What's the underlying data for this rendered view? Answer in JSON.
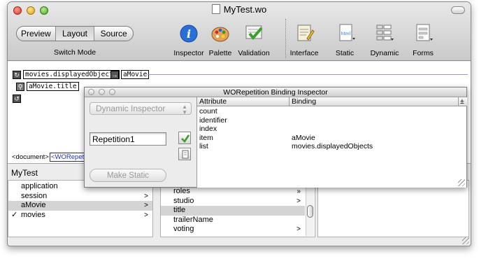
{
  "window": {
    "title": "MyTest.wo"
  },
  "toolbar": {
    "mode_buttons": [
      "Preview",
      "Layout",
      "Source"
    ],
    "mode_selected": "Layout",
    "mode_label": "Switch Mode",
    "items": [
      "Inspector",
      "Palette",
      "Validation",
      "Interface",
      "Static",
      "Dynamic",
      "Forms"
    ]
  },
  "editor": {
    "chip_displayed": "movies.displayedObjects",
    "chip_item": "aMovie",
    "chip_title": "aMovie.title"
  },
  "pathbar": {
    "doc": "<document>",
    "repetition": "<WORepetit"
  },
  "browser": {
    "header": "MyTest",
    "col1": [
      {
        "label": "application",
        "arrow": "",
        "checked": false
      },
      {
        "label": "session",
        "arrow": ">",
        "checked": false
      },
      {
        "label": "aMovie",
        "arrow": ">",
        "checked": false
      },
      {
        "label": "movies",
        "arrow": ">",
        "checked": true
      }
    ],
    "col2": [
      {
        "label": "roles",
        "arrow": "»"
      },
      {
        "label": "studio",
        "arrow": ">"
      },
      {
        "label": "title",
        "arrow": ""
      },
      {
        "label": "trailerName",
        "arrow": ""
      },
      {
        "label": "voting",
        "arrow": ">"
      }
    ]
  },
  "inspector": {
    "title": "WORepetition Binding Inspector",
    "popup": "Dynamic Inspector",
    "name_value": "Repetition1",
    "make_static": "Make Static",
    "headers": [
      "Attribute",
      "Binding"
    ],
    "add": "±",
    "rows": [
      {
        "attr": "count",
        "binding": ""
      },
      {
        "attr": "identifier",
        "binding": ""
      },
      {
        "attr": "index",
        "binding": ""
      },
      {
        "attr": "item",
        "binding": "aMovie"
      },
      {
        "attr": "list",
        "binding": "movies.displayedObjects"
      }
    ]
  },
  "colors": {
    "selection": "#d4d4d4",
    "inspector_blue": "#2a6fd6",
    "check_green": "#3aa02a"
  }
}
